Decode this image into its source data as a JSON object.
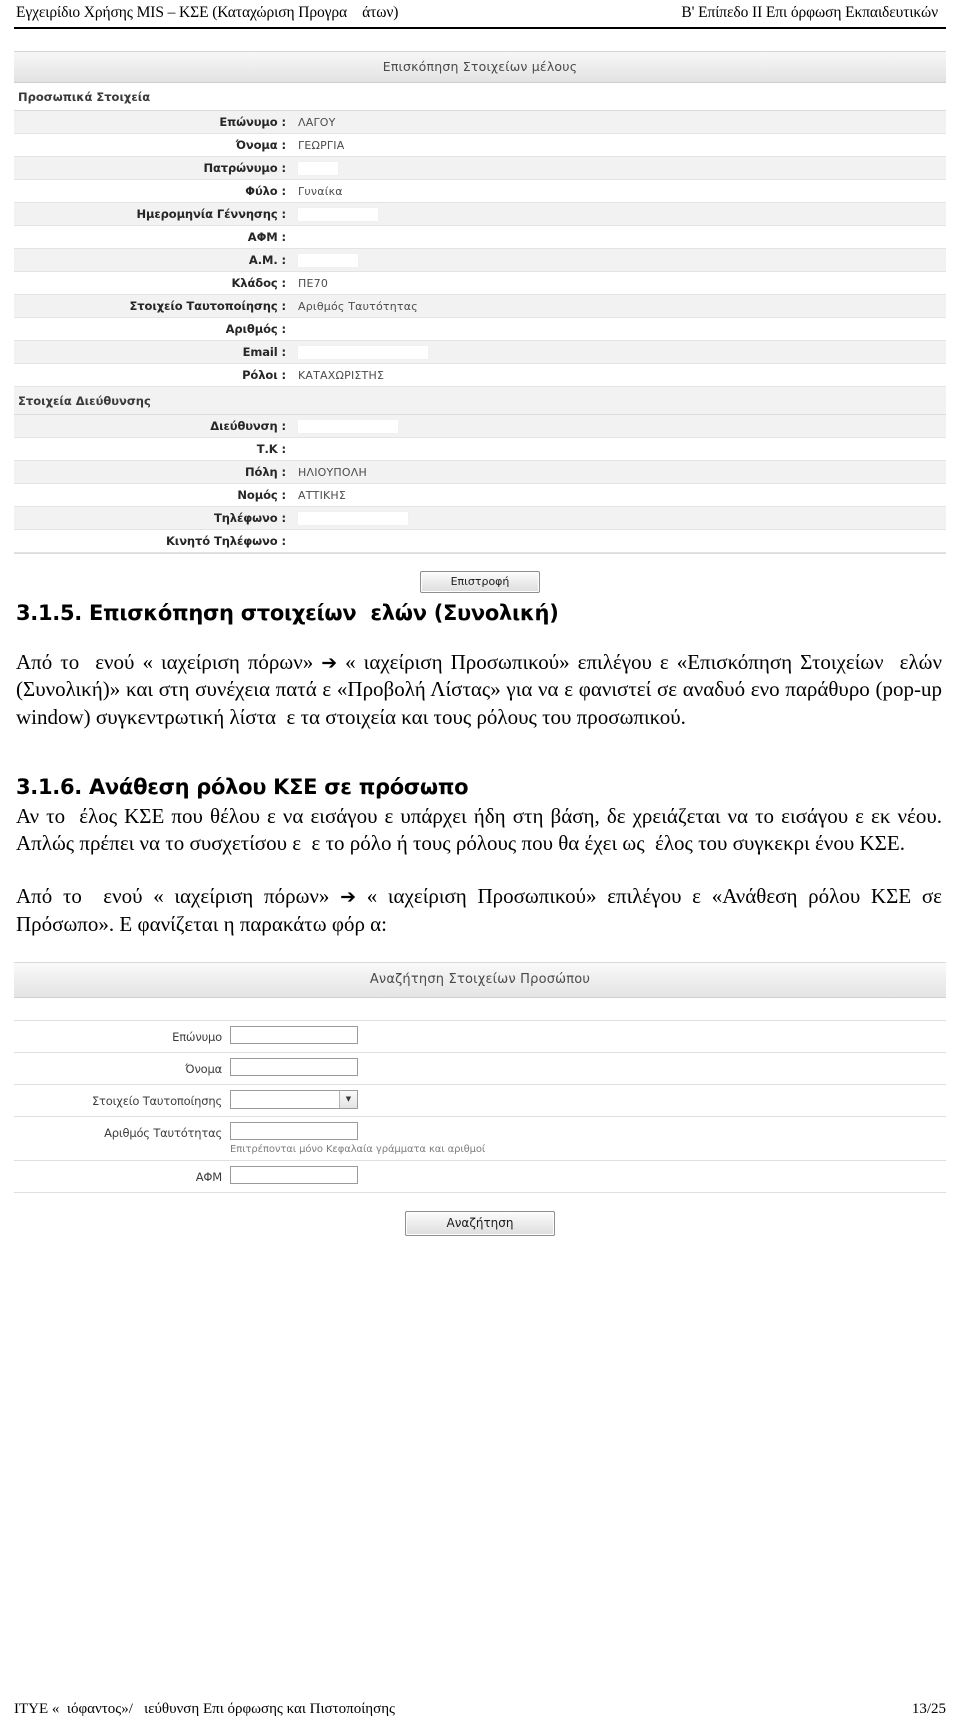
{
  "header": {
    "left": "Εγχειρίδιο Χρήσης MIS – ΚΣΕ (Καταχώριση Προγρα    άτων)",
    "right": "Β' Επίπεδο ΙΙ Επι όρφωση Εκπαιδευτικών"
  },
  "screenshot_member": {
    "title": "Επισκόπηση Στοιχείων μέλους",
    "section_personal": "Προσωπικά Στοιχεία",
    "section_address": "Στοιχεία Διεύθυνσης",
    "fields_personal": [
      {
        "label": "Επώνυμο :",
        "value": "ΛΑΓΟΥ",
        "redacted": false
      },
      {
        "label": "Όνομα :",
        "value": "ΓΕΩΡΓΙΑ",
        "redacted": false
      },
      {
        "label": "Πατρώνυμο :",
        "value": "",
        "redacted": true,
        "redact_width": "w40"
      },
      {
        "label": "Φύλο :",
        "value": "Γυναίκα",
        "redacted": false
      },
      {
        "label": "Ημερομηνία Γέννησης :",
        "value": "",
        "redacted": true,
        "redact_width": "w80"
      },
      {
        "label": "ΑΦΜ :",
        "value": "",
        "redacted": false
      },
      {
        "label": "Α.Μ. :",
        "value": "",
        "redacted": true,
        "redact_width": "w60"
      },
      {
        "label": "Κλάδος :",
        "value": "ΠΕ70",
        "redacted": false
      },
      {
        "label": "Στοιχείο Ταυτοποίησης :",
        "value": "Αριθμός Ταυτότητας",
        "redacted": false
      },
      {
        "label": "Αριθμός :",
        "value": "",
        "redacted": false
      },
      {
        "label": "Email :",
        "value": "",
        "redacted": true,
        "redact_width": "w130"
      },
      {
        "label": "Ρόλοι :",
        "value": "ΚΑΤΑΧΩΡΙΣΤΗΣ",
        "redacted": false
      }
    ],
    "fields_address": [
      {
        "label": "Διεύθυνση :",
        "value": "",
        "redacted": true,
        "redact_width": "w100"
      },
      {
        "label": "Τ.Κ :",
        "value": "",
        "redacted": false
      },
      {
        "label": "Πόλη :",
        "value": "ΗΛΙΟΥΠΟΛΗ",
        "redacted": false
      },
      {
        "label": "Νομός :",
        "value": "ΑΤΤΙΚΗΣ",
        "redacted": false
      },
      {
        "label": "Τηλέφωνο :",
        "value": "",
        "redacted": true,
        "redact_width": "w110"
      },
      {
        "label": "Κινητό Τηλέφωνο :",
        "value": "",
        "redacted": false
      }
    ],
    "back_button": "Επιστροφή"
  },
  "section_315": {
    "heading": "3.1.5. Επισκόπηση στοιχείων  ελών (Συνολική)",
    "paragraph_part1": "Από το  ενού «",
    "paragraph": "Από το  ενού « ιαχείριση πόρων» ➔ « ιαχείριση Προσωπικού» επιλέγου ε «Επισκόπηση Στοιχείων  ελών (Συνολική)» και στη συνέχεια πατά ε «Προβολή Λίστας» για να ε φανιστεί σε αναδυό ενο παράθυρο (pop-up window) συγκεντρωτική λίστα  ε τα στοιχεία και τους ρόλους του προσωπικού.",
    "text_a": "Από το  ενού « ιαχείριση πόρων» ",
    "arrow": "➔",
    "text_b": " « ιαχείριση Προσωπικού» επιλέγου ε «Επισκόπηση Στοιχείων  ελών (Συνολική)» και στη συνέχεια πατά ε «Προβολή Λίστας» για να ε φανιστεί σε αναδυό ενο παράθυρο (pop-up window) συγκεντρωτική λίστα  ε τα στοιχεία και τους ρόλους του προσωπικού."
  },
  "section_316": {
    "heading": "3.1.6. Ανάθεση ρόλου ΚΣΕ σε πρόσωπο",
    "paragraph_1": "Αν το  έλος ΚΣΕ που θέλου ε να εισάγου ε υπάρχει ήδη στη βάση, δε χρειάζεται να το εισάγου ε εκ νέου. Απλώς πρέπει να το συσχετίσου ε  ε το ρόλο ή τους ρόλους που θα έχει ως  έλος του συγκεκρι ένου ΚΣΕ.",
    "text_a": "Από το  ενού « ιαχείριση πόρων» ",
    "arrow": "➔",
    "text_b": " « ιαχείριση Προσωπικού» επιλέγου ε «Ανάθεση ρόλου ΚΣΕ σε Πρόσωπο». Ε φανίζεται η παρακάτω φόρ α:"
  },
  "screenshot_search": {
    "title": "Αναζήτηση Στοιχείων Προσώπου",
    "fields": [
      {
        "label": "Επώνυμο",
        "type": "text",
        "value": "",
        "hint": ""
      },
      {
        "label": "Όνομα",
        "type": "text",
        "value": "",
        "hint": ""
      },
      {
        "label": "Στοιχείο Ταυτοποίησης",
        "type": "select",
        "value": "",
        "hint": ""
      },
      {
        "label": "Αριθμός Ταυτότητας",
        "type": "text",
        "value": "",
        "hint": "Επιτρέπονται μόνο Κεφαλαία γράμματα και αριθμοί"
      },
      {
        "label": "ΑΦΜ",
        "type": "text",
        "value": "",
        "hint": ""
      }
    ],
    "search_button": "Αναζήτηση",
    "dropdown_arrow_icon": "▼"
  },
  "footer": {
    "left": "ΙΤΥΕ «  ιόφαντος»/   ιεύθυνση Επι όρφωσης και Πιστοποίησης",
    "right": "13/25"
  }
}
